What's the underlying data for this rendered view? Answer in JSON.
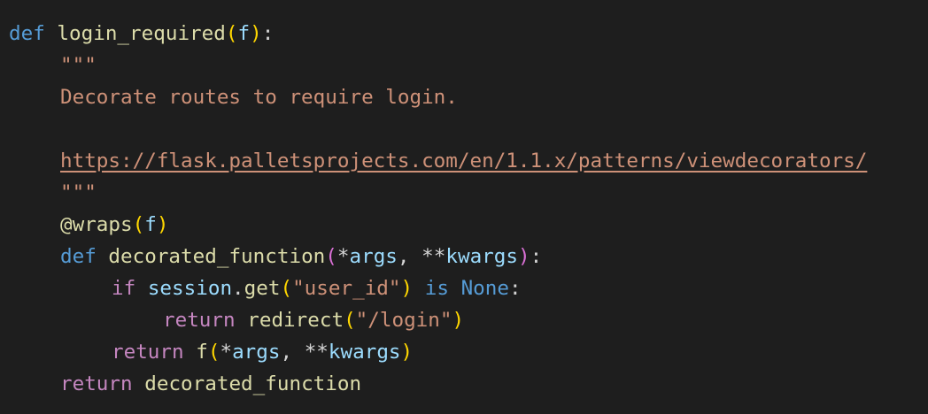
{
  "code": {
    "l1": {
      "kw": "def",
      "name": "login_required",
      "open": "(",
      "param": "f",
      "close": ")",
      "colon": ":"
    },
    "l2": {
      "quote": "\"\"\""
    },
    "l3": {
      "text": "Decorate routes to require login."
    },
    "l5": {
      "url": "https://flask.palletsprojects.com/en/1.1.x/patterns/viewdecorators/"
    },
    "l6": {
      "quote": "\"\"\""
    },
    "l7": {
      "decorator": "@wraps",
      "open": "(",
      "arg": "f",
      "close": ")"
    },
    "l8": {
      "kw": "def",
      "name": "decorated_function",
      "open": "(",
      "star": "*",
      "args": "args",
      "comma": ", ",
      "dstar": "**",
      "kwargs": "kwargs",
      "close": ")",
      "colon": ":"
    },
    "l9": {
      "kw": "if",
      "obj": "session",
      "dot": ".",
      "method": "get",
      "open": "(",
      "str": "\"user_id\"",
      "close": ")",
      "is": "is",
      "none": "None",
      "colon": ":"
    },
    "l10": {
      "kw": "return",
      "fn": "redirect",
      "open": "(",
      "str": "\"/login\"",
      "close": ")"
    },
    "l11": {
      "kw": "return",
      "fn": "f",
      "open": "(",
      "star": "*",
      "args": "args",
      "comma": ", ",
      "dstar": "**",
      "kwargs": "kwargs",
      "close": ")"
    },
    "l12": {
      "kw": "return",
      "name": "decorated_function"
    }
  },
  "colors": {
    "background": "#1e1e1e",
    "keyword": "#569cd6",
    "control": "#c586c0",
    "function": "#dcdcaa",
    "variable": "#9cdcfe",
    "string": "#ce9178",
    "bracket": "#ffd700",
    "bracket_nested": "#da70d6"
  }
}
